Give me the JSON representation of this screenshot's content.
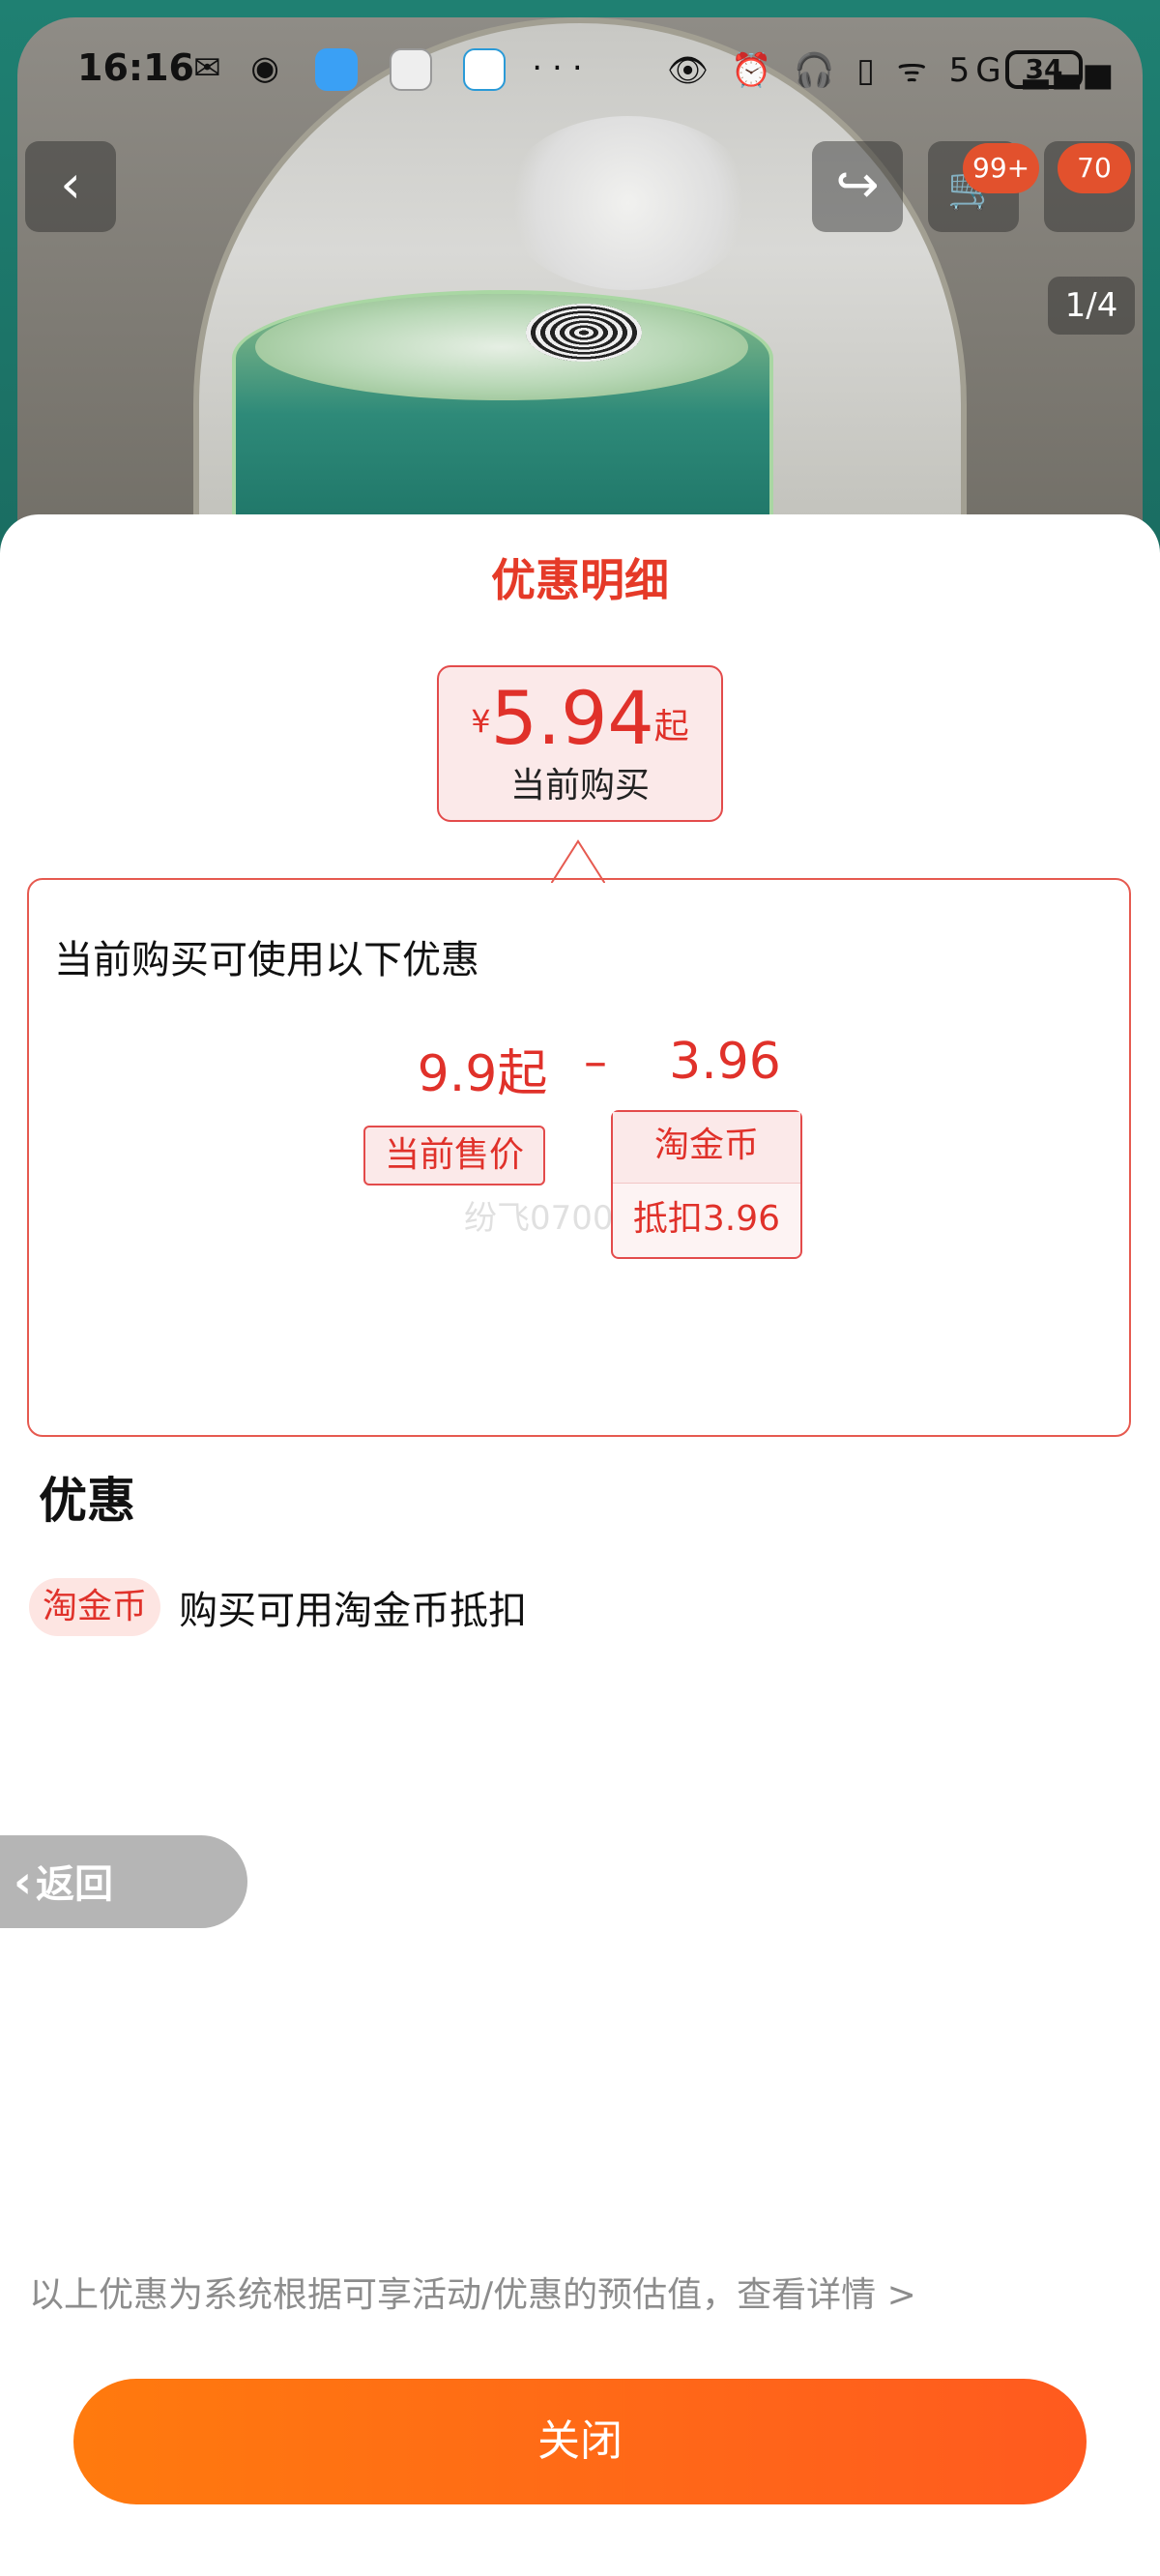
{
  "status_bar": {
    "time": "16:16",
    "left_icons": "✉ ◉",
    "right_icons": "👁 ⏰ 🎧 ▯ ᯤ 5G ▂▃▅",
    "battery": "34",
    "more_label": "···"
  },
  "product_nav": {
    "back_icon": "‹",
    "share_icon": "↪",
    "cart_icon": "🛒",
    "more_icon": "⋯",
    "cart_badge": "99+",
    "message_badge": "70",
    "image_counter": "1/4"
  },
  "sheet": {
    "title": "优惠明细",
    "current_price": {
      "currency": "¥",
      "value": "5.94",
      "suffix": "起",
      "caption": "当前购买"
    },
    "detail_heading": "当前购买可使用以下优惠",
    "formula": {
      "original": "9.9起",
      "operator": "–",
      "deduction": "3.96",
      "original_tag": "当前售价",
      "coin_name": "淘金币",
      "coin_amount": "抵扣3.96"
    },
    "watermark": "纷飞0700",
    "section_title": "优惠",
    "promotion": {
      "tag": "淘金币",
      "text": "购买可用淘金币抵扣"
    },
    "return_label": "返回",
    "disclaimer": "以上优惠为系统根据可享活动/优惠的预估值，查看详情 >",
    "close_label": "关闭"
  },
  "colors": {
    "accent_red": "#e0312a",
    "button_orange_start": "#ff7a0e",
    "button_orange_end": "#ff5a1f"
  }
}
